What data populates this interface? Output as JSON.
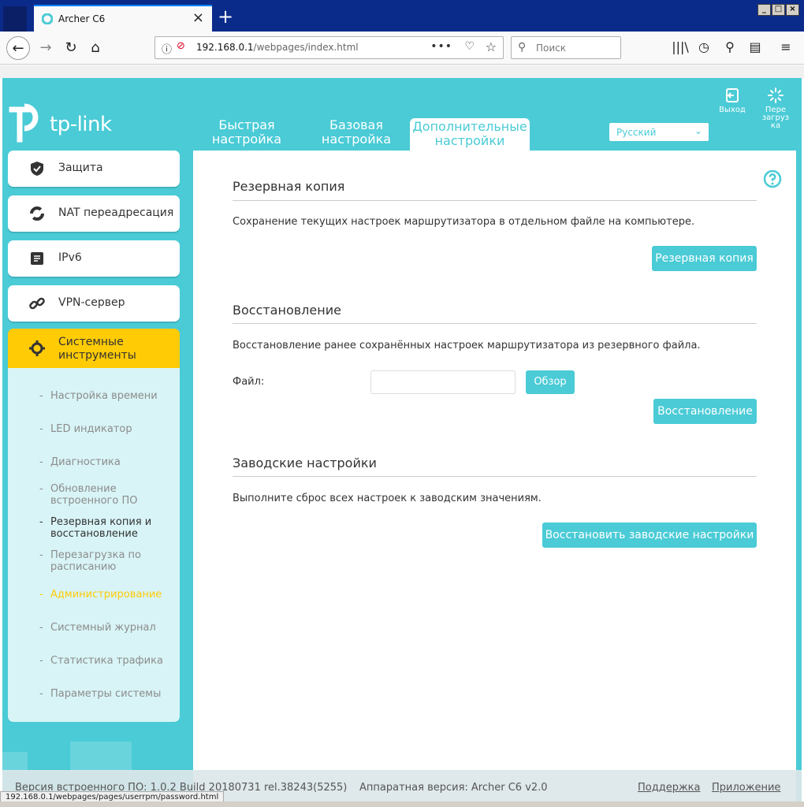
{
  "browser": {
    "tab_title": "Archer C6",
    "url_host": "192.168.0.1",
    "url_path": "/webpages/index.html",
    "search_placeholder": "Поиск",
    "status_url": "192.168.0.1/webpages/pages/userrpm/password.html"
  },
  "header": {
    "logo_text": "tp-link",
    "tabs": [
      {
        "line1": "Быстрая",
        "line2": "настройка"
      },
      {
        "line1": "Базовая",
        "line2": "настройка"
      },
      {
        "line1": "Дополнительные",
        "line2": "настройки"
      }
    ],
    "language": "Русский",
    "logout_label": "Выход",
    "reboot_label_1": "Пере",
    "reboot_label_2": "загруз",
    "reboot_label_3": "ка"
  },
  "sidebar": {
    "items": [
      {
        "label": "Защита",
        "icon": "shield-icon"
      },
      {
        "label": "NAT переадресация",
        "icon": "nat-icon"
      },
      {
        "label": "IPv6",
        "icon": "ipv6-icon"
      },
      {
        "label": "VPN-сервер",
        "icon": "link-icon"
      },
      {
        "label_1": "Системные",
        "label_2": "инструменты",
        "icon": "gear-icon"
      }
    ],
    "subitems": [
      {
        "l1": "Настройка времени",
        "l2": ""
      },
      {
        "l1": "LED индикатор",
        "l2": ""
      },
      {
        "l1": "Диагностика",
        "l2": ""
      },
      {
        "l1": "Обновление",
        "l2": "встроенного ПО"
      },
      {
        "l1": "Резервная копия и",
        "l2": "восстановление"
      },
      {
        "l1": "Перезагрузка по",
        "l2": "расписанию"
      },
      {
        "l1": "Администрирование",
        "l2": ""
      },
      {
        "l1": "Системный журнал",
        "l2": ""
      },
      {
        "l1": "Статистика трафика",
        "l2": ""
      },
      {
        "l1": "Параметры системы",
        "l2": ""
      }
    ],
    "dash": "-"
  },
  "content": {
    "backup": {
      "title": "Резервная копия",
      "desc": "Сохранение текущих настроек маршрутизатора в отдельном файле на компьютере.",
      "button": "Резервная копия"
    },
    "restore": {
      "title": "Восстановление",
      "desc": "Восстановление ранее сохранённых настроек маршрутизатора из резервного файла.",
      "file_label": "Файл:",
      "browse": "Обзор",
      "button": "Восстановление"
    },
    "factory": {
      "title": "Заводские настройки",
      "desc": "Выполните сброс всех настроек к заводским значениям.",
      "button": "Восстановить заводские настройки"
    }
  },
  "footer": {
    "firmware": "Версия встроенного ПО: 1.0.2 Build 20180731 rel.38243(5255)",
    "hardware": "Аппаратная версия: Archer C6 v2.0",
    "support": "Поддержка",
    "app": "Приложение"
  },
  "colors": {
    "brand": "#4acbd6",
    "active": "#ffcb05"
  }
}
